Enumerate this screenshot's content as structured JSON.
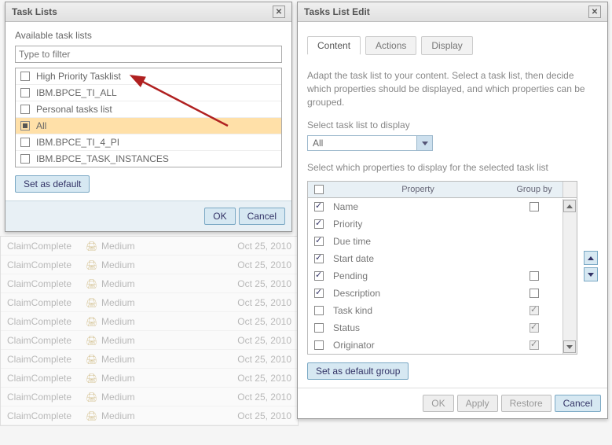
{
  "bg": {
    "col1": "ClaimComplete",
    "col3": "Medium",
    "col4": "Oct 25, 2010",
    "rows": 10
  },
  "leftDialog": {
    "title": "Task Lists",
    "availableLabel": "Available task lists",
    "filterPlaceholder": "Type to filter",
    "items": [
      {
        "label": "High Priority Tasklist",
        "checked": false
      },
      {
        "label": "IBM.BPCE_TI_ALL",
        "checked": false
      },
      {
        "label": "Personal tasks list",
        "checked": false
      },
      {
        "label": "All",
        "checked": true
      },
      {
        "label": "IBM.BPCE_TI_4_PI",
        "checked": false
      },
      {
        "label": "IBM.BPCE_TASK_INSTANCES",
        "checked": false
      }
    ],
    "setDefault": "Set as default",
    "ok": "OK",
    "cancel": "Cancel"
  },
  "rightDialog": {
    "title": "Tasks List Edit",
    "tabs": [
      {
        "label": "Content",
        "active": true
      },
      {
        "label": "Actions",
        "active": false
      },
      {
        "label": "Display",
        "active": false
      }
    ],
    "helpText": "Adapt the task list to your content. Select a task list, then decide which properties should be displayed, and which properties can be grouped.",
    "selectLabel": "Select task list to display",
    "selectValue": "All",
    "propsLabel": "Select which properties to display for the selected task list",
    "tableHead": {
      "property": "Property",
      "groupBy": "Group by"
    },
    "properties": [
      {
        "name": "Name",
        "display": true,
        "group": false,
        "groupDisabled": false
      },
      {
        "name": "Priority",
        "display": true,
        "group": null,
        "groupDisabled": false
      },
      {
        "name": "Due time",
        "display": true,
        "group": null,
        "groupDisabled": false
      },
      {
        "name": "Start date",
        "display": true,
        "group": null,
        "groupDisabled": false
      },
      {
        "name": "Pending",
        "display": true,
        "group": false,
        "groupDisabled": false
      },
      {
        "name": "Description",
        "display": true,
        "group": false,
        "groupDisabled": false
      },
      {
        "name": "Task kind",
        "display": false,
        "group": true,
        "groupDisabled": true
      },
      {
        "name": "Status",
        "display": false,
        "group": true,
        "groupDisabled": true
      },
      {
        "name": "Originator",
        "display": false,
        "group": true,
        "groupDisabled": true
      }
    ],
    "setDefaultGroup": "Set as default group",
    "buttons": {
      "ok": "OK",
      "apply": "Apply",
      "restore": "Restore",
      "cancel": "Cancel"
    }
  }
}
